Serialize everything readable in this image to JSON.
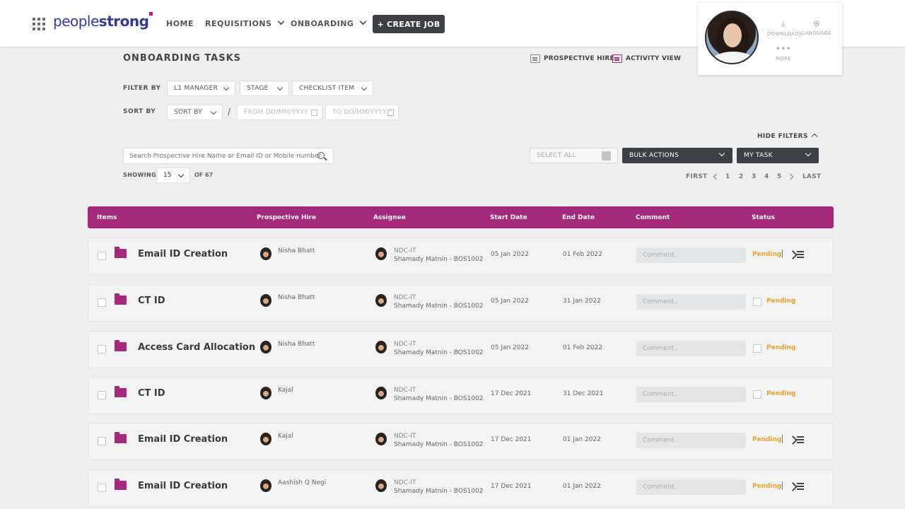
{
  "header": {
    "logo_regular": "people",
    "logo_bold": "strong",
    "nav": {
      "home": "HOME",
      "requisitions": "REQUISITIONS",
      "onboarding": "ONBOARDING"
    },
    "create_job": "+ CREATE JOB",
    "downloads": "DOWNLOADS",
    "language": "LANGUAGE",
    "more": "MORE"
  },
  "page": {
    "title": "ONBOARDING TASKS",
    "view_prospective": "PROSPECTIVE HIRE",
    "view_activity": "ACTIVITY VIEW"
  },
  "filters": {
    "filter_by": "FILTER BY",
    "l1_manager": "L1 MANAGER",
    "stage": "STAGE",
    "checklist_item": "CHECKLIST ITEM",
    "sort_by_label": "SORT BY",
    "sort_by": "SORT BY",
    "from": "FROM  DD/MM/YYYY",
    "to": "TO  DD/MM/YYYY",
    "hide_filters": "HIDE FILTERS"
  },
  "toolbar": {
    "search_placeholder": "Search Prospective Hire Name or Email ID or Mobile number",
    "select_all": "SELECT ALL",
    "bulk_actions": "BULK ACTIONS",
    "my_task": "MY TASK",
    "showing": "SHOWING",
    "page_size": "15",
    "of_total": "OF 67"
  },
  "pager": {
    "first": "FIRST",
    "pages": [
      "1",
      "2",
      "3",
      "4",
      "5"
    ],
    "last": "LAST"
  },
  "table": {
    "headers": {
      "items": "Items",
      "hire": "Prospective Hire",
      "assignee": "Assignee",
      "start": "Start Date",
      "end": "End Date",
      "comment": "Comment",
      "status": "Status"
    },
    "comment_placeholder": "Comment..",
    "rows": [
      {
        "item": "Email ID Creation",
        "hire": "Nisha Bhatt",
        "team": "NDC-IT",
        "assignee": "Shamady Matnin - BOS1002",
        "start": "05 Jan 2022",
        "end": "01 Feb 2022",
        "status": "Pending"
      },
      {
        "item": "CT ID",
        "hire": "Nisha Bhatt",
        "team": "NDC-IT",
        "assignee": "Shamady Matnin - BOS1002",
        "start": "05 Jan 2022",
        "end": "31 Jan 2022",
        "status": "Pending"
      },
      {
        "item": "Access Card Allocation",
        "hire": "Nisha Bhatt",
        "team": "NDC-IT",
        "assignee": "Shamady Matnin - BOS1002",
        "start": "05 Jan 2022",
        "end": "01 Feb 2022",
        "status": "Pending"
      },
      {
        "item": "CT ID",
        "hire": "Kajal",
        "team": "NDC-IT",
        "assignee": "Shamady Matnin - BOS1002",
        "start": "17 Dec 2021",
        "end": "31 Dec 2021",
        "status": "Pending"
      },
      {
        "item": "Email ID Creation",
        "hire": "Kajal",
        "team": "NDC-IT",
        "assignee": "Shamady Matnin - BOS1002",
        "start": "17 Dec 2021",
        "end": "01 Jan 2022",
        "status": "Pending"
      },
      {
        "item": "Email ID Creation",
        "hire": "Aashish Q Negi",
        "team": "NDC-IT",
        "assignee": "Shamady Matnin - BOS1002",
        "start": "17 Dec 2021",
        "end": "01 Jan 2022",
        "status": "Pending"
      }
    ]
  },
  "colors": {
    "brand": "#a5297a",
    "pending": "#f0a030",
    "dark": "#3c4046"
  }
}
